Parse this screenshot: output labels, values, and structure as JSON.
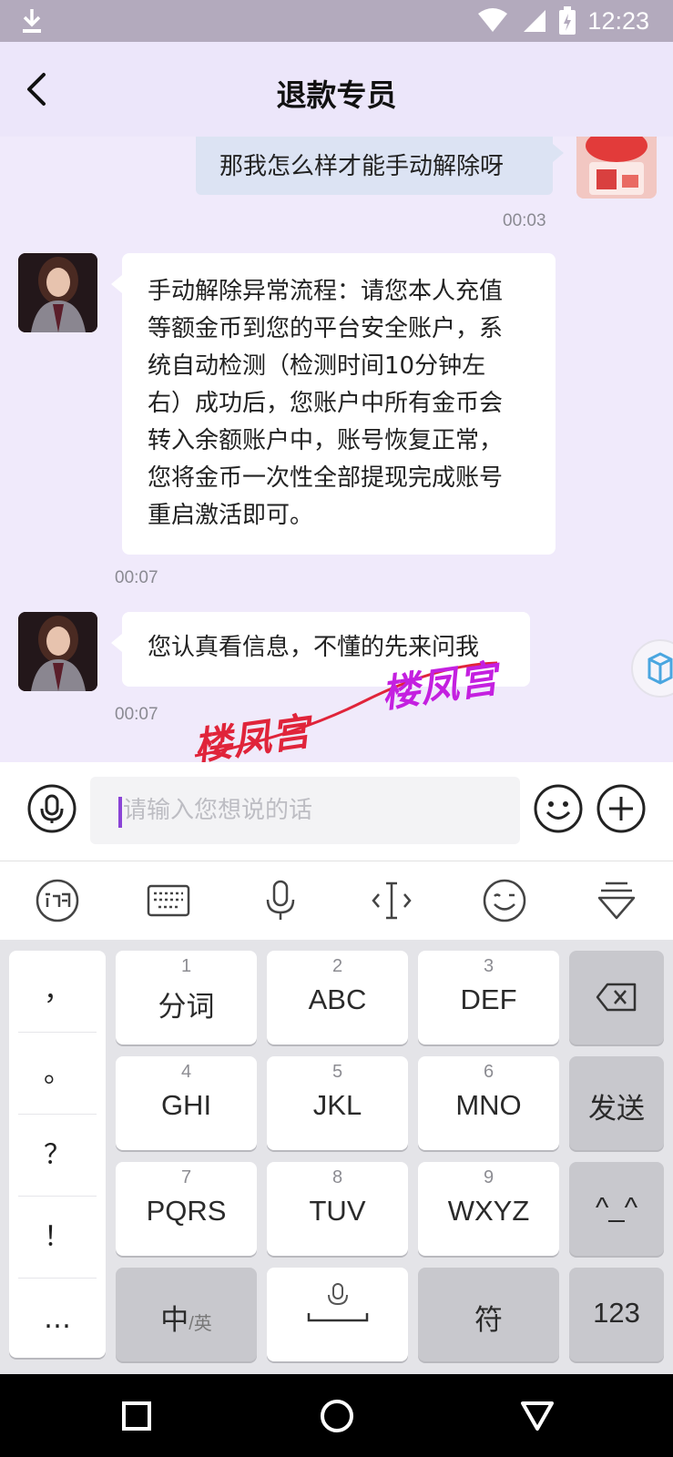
{
  "status_bar": {
    "time": "12:23"
  },
  "header": {
    "title": "退款专员"
  },
  "messages": [
    {
      "side": "right",
      "text": "那我怎么样才能手动解除呀",
      "time": "00:03"
    },
    {
      "side": "left",
      "lines": [
        "手动解除异常流程：请您本人充值",
        "等额金币到您的平台安全账户，系",
        "统自动检测（检测时间10分钟左",
        "右）成功后，您账户中所有金币会",
        "转入余额账户中，账号恢复正常，",
        "您将金币一次性全部提现完成账号",
        "重启激活即可。"
      ],
      "time": "00:07"
    },
    {
      "side": "left",
      "text": "您认真看信息，不懂的先来问我",
      "time": "00:07"
    }
  ],
  "watermarks": [
    "楼凤宫",
    "楼凤宫"
  ],
  "watermark_colors": {
    "first": "#e0243a",
    "second": "#c420e0"
  },
  "input": {
    "placeholder": "请输入您想说的话"
  },
  "keyboard": {
    "punctuation": [
      "，",
      "。",
      "？",
      "！",
      "…"
    ],
    "keys": [
      {
        "num": "1",
        "label": "分词"
      },
      {
        "num": "2",
        "label": "ABC"
      },
      {
        "num": "3",
        "label": "DEF"
      },
      {
        "num": "4",
        "label": "GHI"
      },
      {
        "num": "5",
        "label": "JKL"
      },
      {
        "num": "6",
        "label": "MNO"
      },
      {
        "num": "7",
        "label": "PQRS"
      },
      {
        "num": "8",
        "label": "TUV"
      },
      {
        "num": "9",
        "label": "WXYZ"
      }
    ],
    "send": "发送",
    "emoticon": "^_^",
    "lang_main": "中",
    "lang_sub": "/英",
    "symbols": "符",
    "numbers": "123"
  },
  "colors": {
    "accent": "#8a43d6",
    "header_bg": "#ece6fa",
    "bubble_right": "#dce3f3"
  }
}
